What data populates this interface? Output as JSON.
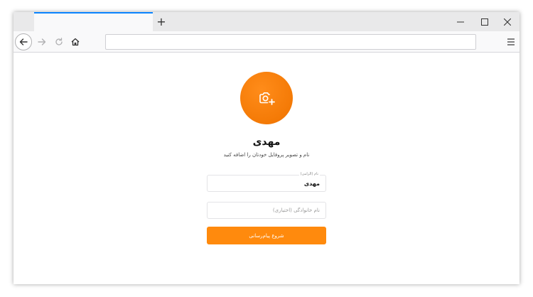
{
  "browser": {
    "new_tab_symbol": "+",
    "url": "",
    "controls": {
      "minimize": "minimize-icon",
      "maximize": "maximize-icon",
      "close": "close-icon"
    }
  },
  "profile": {
    "avatar_icon": "camera-plus-icon",
    "name": "مهدی",
    "subtitle": "نام و تصویر پروفایل خودتان را اضافه کنید",
    "first_name_label": "نام (الزامی)",
    "first_name_value": "مهدی",
    "last_name_placeholder": "نام خانوادگی (اختیاری)",
    "start_button": "شروع پیام‌رسانی"
  },
  "colors": {
    "accent": "#ff8a0d",
    "tab_highlight": "#0a84ff"
  }
}
